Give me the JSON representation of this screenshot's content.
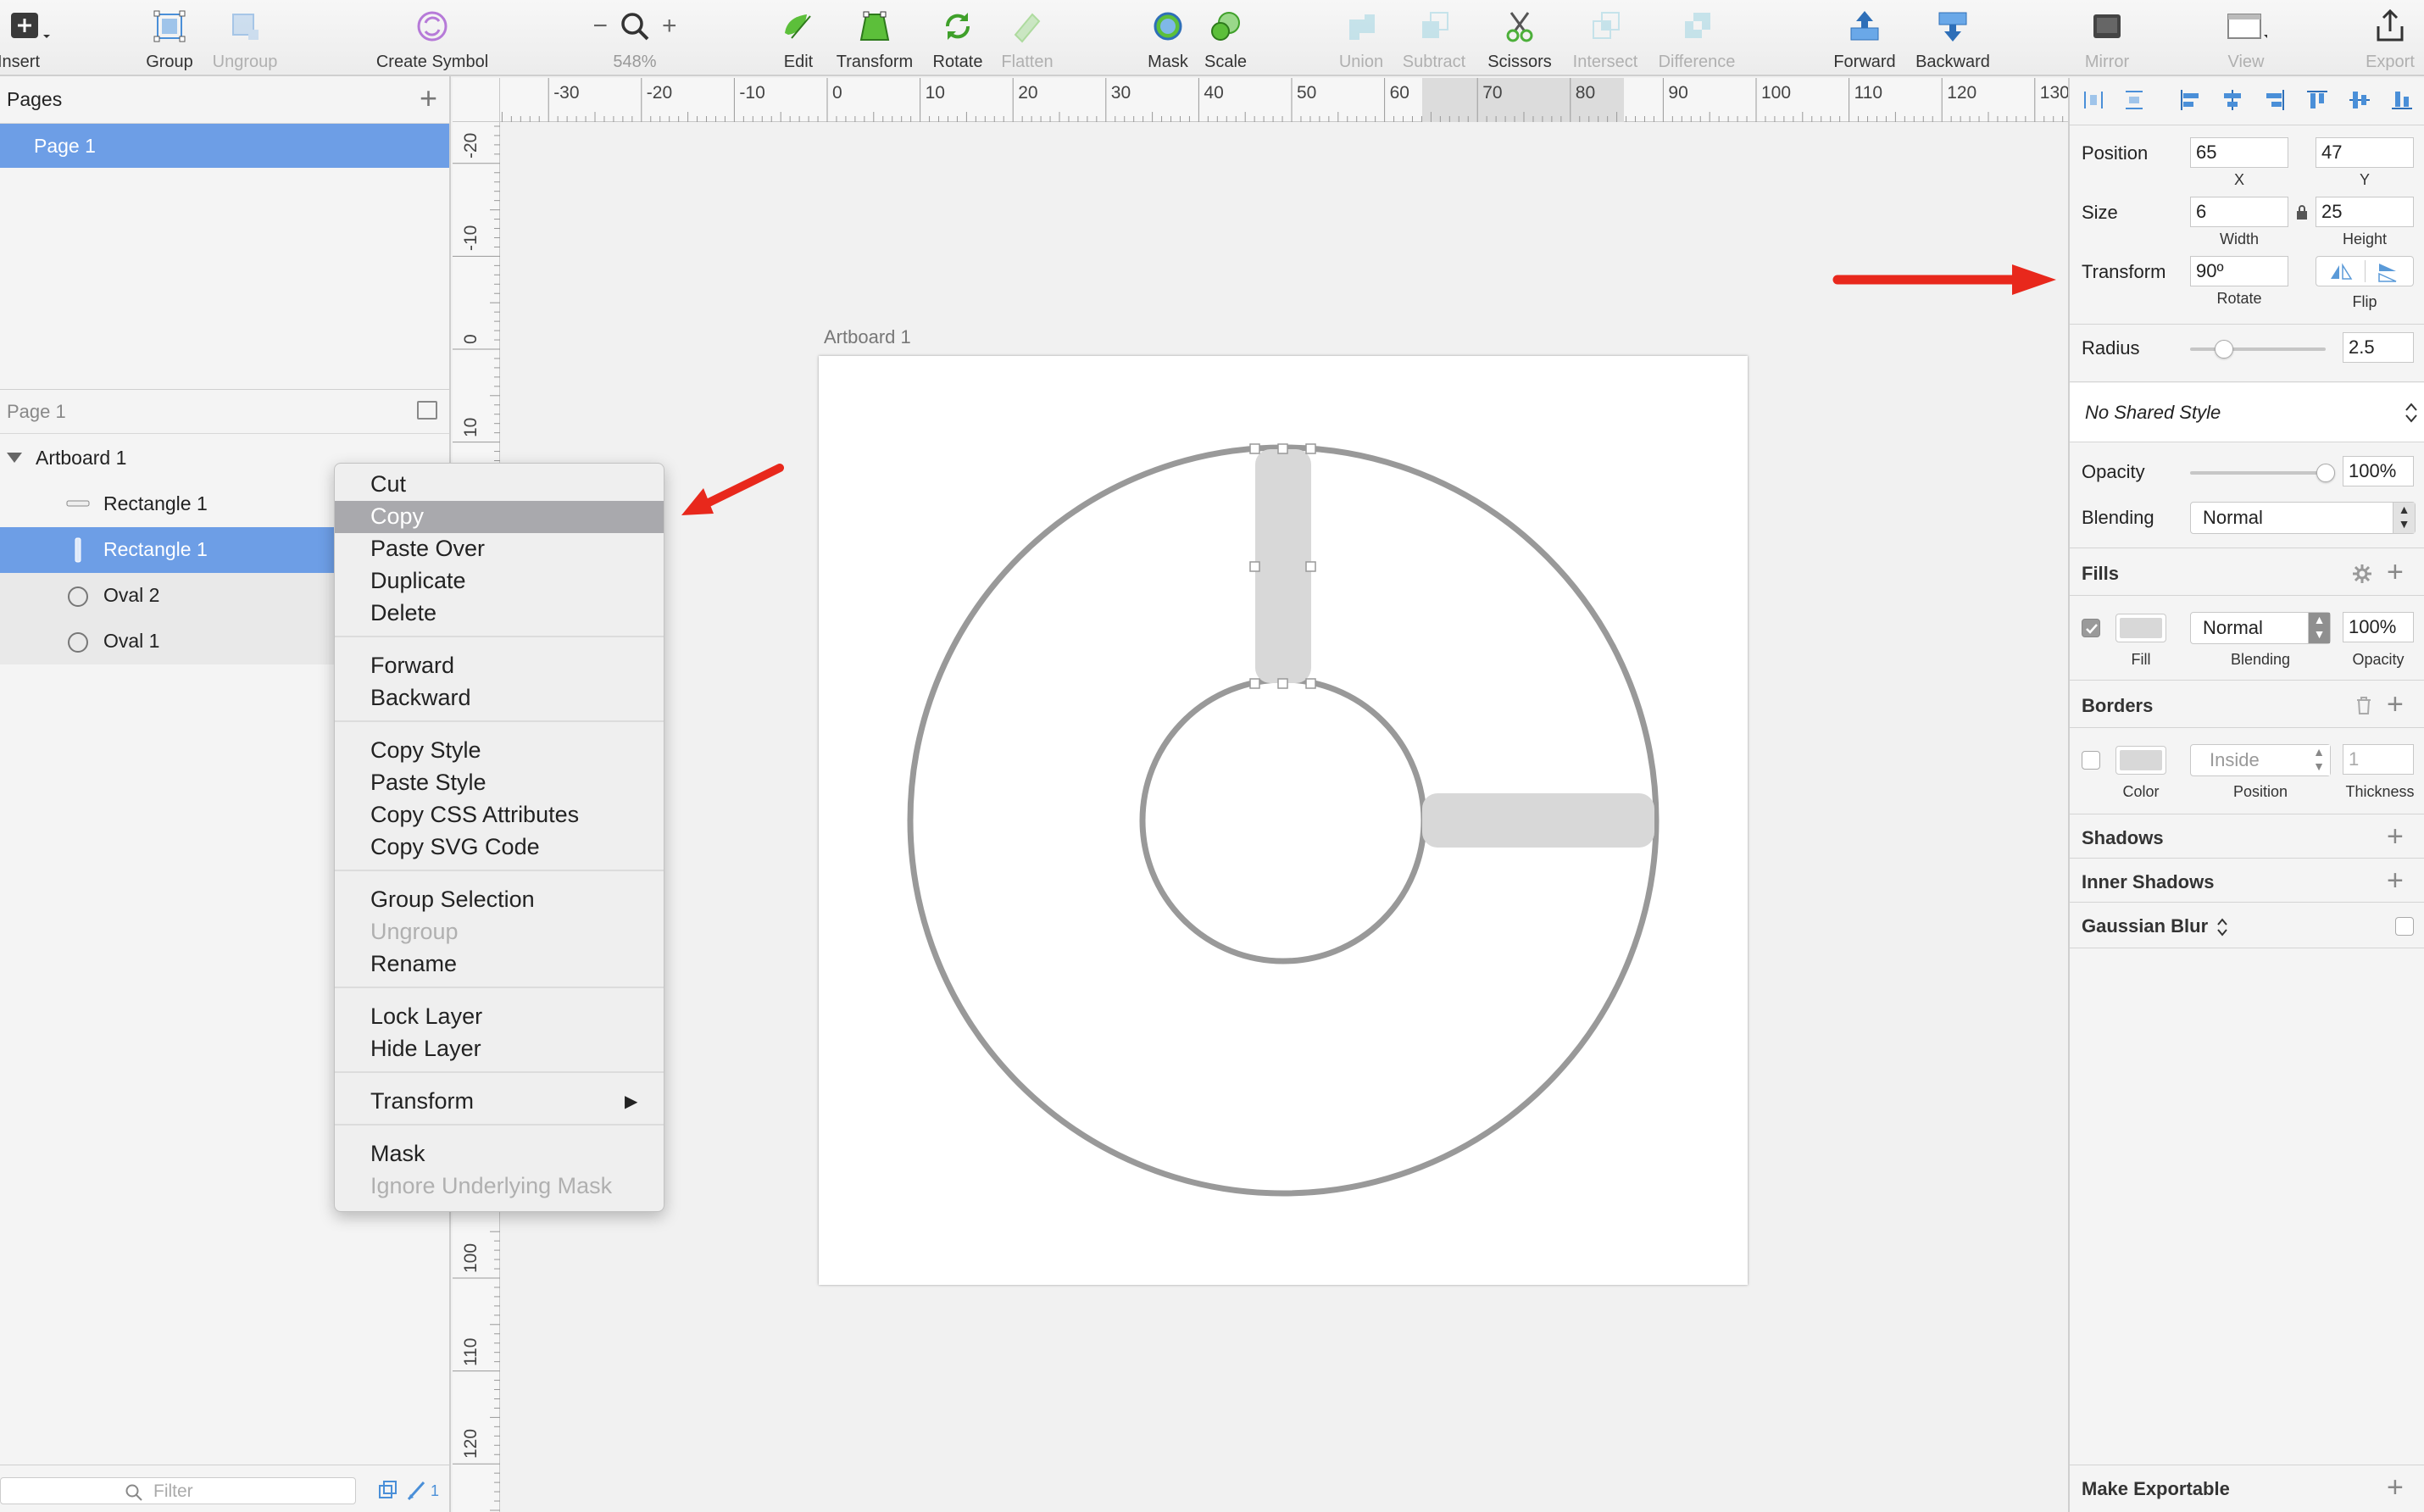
{
  "toolbar": {
    "insert": "Insert",
    "group": "Group",
    "ungroup": "Ungroup",
    "create_symbol": "Create Symbol",
    "zoom_minus": "−",
    "zoom_plus": "+",
    "zoom_level": "548%",
    "edit": "Edit",
    "transform": "Transform",
    "rotate": "Rotate",
    "flatten": "Flatten",
    "mask": "Mask",
    "scale": "Scale",
    "union": "Union",
    "subtract": "Subtract",
    "scissors": "Scissors",
    "intersect": "Intersect",
    "difference": "Difference",
    "forward": "Forward",
    "backward": "Backward",
    "mirror": "Mirror",
    "view": "View",
    "export": "Export"
  },
  "pages": {
    "header": "Pages",
    "items": [
      {
        "label": "Page 1"
      }
    ]
  },
  "layers": {
    "header": "Page 1",
    "items": [
      {
        "label": "Artboard 1",
        "icon": "disclosure-triangle-icon"
      },
      {
        "label": "Rectangle 1",
        "icon": "rectangle-horizontal-icon"
      },
      {
        "label": "Rectangle 1",
        "icon": "rectangle-vertical-icon"
      },
      {
        "label": "Oval 2",
        "icon": "oval-icon"
      },
      {
        "label": "Oval 1",
        "icon": "oval-icon"
      }
    ]
  },
  "filter": {
    "placeholder": "Filter",
    "badge": "1"
  },
  "ruler": {
    "top": [
      "-30",
      "-20",
      "-10",
      "0",
      "10",
      "20",
      "30",
      "40",
      "50",
      "60",
      "70",
      "80",
      "90",
      "100",
      "110",
      "120",
      "130"
    ],
    "left": [
      "-20",
      "-10",
      "0",
      "10",
      "100",
      "110",
      "120"
    ]
  },
  "canvas": {
    "artboard_title": "Artboard 1"
  },
  "context_menu": {
    "groups": [
      [
        "Cut",
        "Copy",
        "Paste Over",
        "Duplicate",
        "Delete"
      ],
      [
        "Forward",
        "Backward"
      ],
      [
        "Copy Style",
        "Paste Style",
        "Copy CSS Attributes",
        "Copy SVG Code"
      ],
      [
        "Group Selection",
        "Ungroup",
        "Rename"
      ],
      [
        "Lock Layer",
        "Hide Layer"
      ],
      [
        "Transform"
      ],
      [
        "Mask",
        "Ignore Underlying Mask"
      ]
    ],
    "active": "Copy",
    "disabled": [
      "Ungroup",
      "Ignore Underlying Mask"
    ],
    "submenu_arrow": "▶"
  },
  "inspector": {
    "position": {
      "label": "Position",
      "x": "65",
      "y": "47",
      "x_label": "X",
      "y_label": "Y"
    },
    "size": {
      "label": "Size",
      "width": "6",
      "height": "25",
      "width_label": "Width",
      "height_label": "Height"
    },
    "transform": {
      "label": "Transform",
      "rotate": "90º",
      "rotate_label": "Rotate",
      "flip_label": "Flip"
    },
    "radius": {
      "label": "Radius",
      "value": "2.5",
      "slider": 0.25
    },
    "shared_style": "No Shared Style",
    "opacity": {
      "label": "Opacity",
      "value": "100%",
      "slider": 1.0
    },
    "blending": {
      "label": "Blending",
      "value": "Normal"
    },
    "fills": {
      "title": "Fills",
      "blending": "Normal",
      "opacity": "100%",
      "col_fill": "Fill",
      "col_blending": "Blending",
      "col_opacity": "Opacity",
      "color": "#d8d8d8"
    },
    "borders": {
      "title": "Borders",
      "position": "Inside",
      "thickness": "1",
      "col_color": "Color",
      "col_position": "Position",
      "col_thickness": "Thickness"
    },
    "shadows": "Shadows",
    "inner_shadows": "Inner Shadows",
    "gaussian_blur": "Gaussian Blur",
    "make_exportable": "Make Exportable"
  },
  "colors": {
    "selection": "#6d9ee6",
    "accent_green": "#5cbf3a",
    "annotation_red": "#e8281c",
    "shape_stroke": "#999999",
    "shape_fill": "#d8d8d8"
  }
}
